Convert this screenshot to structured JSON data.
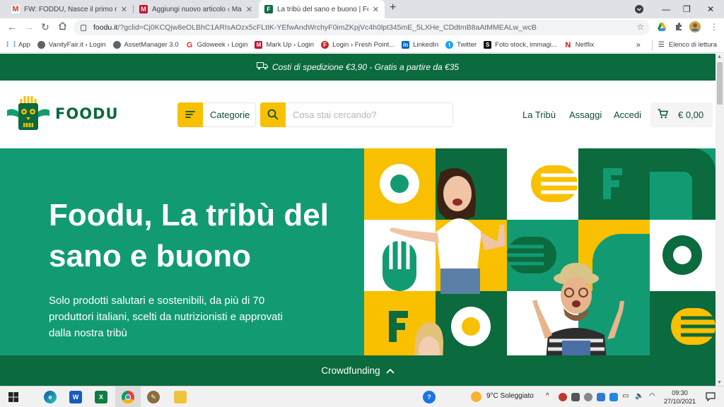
{
  "browser": {
    "tabs": [
      {
        "title": "FW: FODDU, Nasce il primo mod",
        "favicon": "gmail-icon",
        "active": false
      },
      {
        "title": "Aggiungi nuovo articolo ‹ Mark U",
        "favicon": "markup-icon",
        "active": false
      },
      {
        "title": "La tribù del sano e buono | Food",
        "favicon": "foodu-icon",
        "active": true
      }
    ],
    "url_host": "foodu.it",
    "url_rest": "/?gclid=Cj0KCQjw8eOLBhC1ARIsAOzx5cFLtIK-YEfwAndWrchyF0imZKpjVc4h0lpt345mE_5LXHe_CDdtmB8aAtMMEALw_wcB",
    "bookmarks": [
      "App",
      "VanityFair.it › Login",
      "AssetManager 3.0",
      "Gdoweek › Login",
      "Mark Up › Login",
      "Login › Fresh Point...",
      "LinkedIn",
      "Twitter",
      "Foto stock, immagi...",
      "Netflix"
    ],
    "more_bookmarks": "»",
    "reading_list": "Elenco di lettura"
  },
  "site": {
    "shipping_banner": "Costi di spedizione €3,90 - Gratis a partire da €35",
    "logo_text": "FOODU",
    "categories_label": "Categorie",
    "search_placeholder": "Cosa stai cercando?",
    "nav": [
      "La Tribù",
      "Assaggi",
      "Accedi"
    ],
    "cart_total": "€ 0,00",
    "hero": {
      "title": "Foodu, La tribù del sano e buono",
      "subtitle": "Solo prodotti salutari e sostenibili, da più di 70 produttori italiani, scelti da nutrizionisti e approvati dalla nostra tribù"
    },
    "crowdfunding_label": "Crowdfunding",
    "colors": {
      "green_dark": "#0b6a3e",
      "green_light": "#129b73",
      "yellow": "#f9c000"
    }
  },
  "taskbar": {
    "weather": "9°C  Soleggiato",
    "time": "09:30",
    "date": "27/10/2021"
  }
}
